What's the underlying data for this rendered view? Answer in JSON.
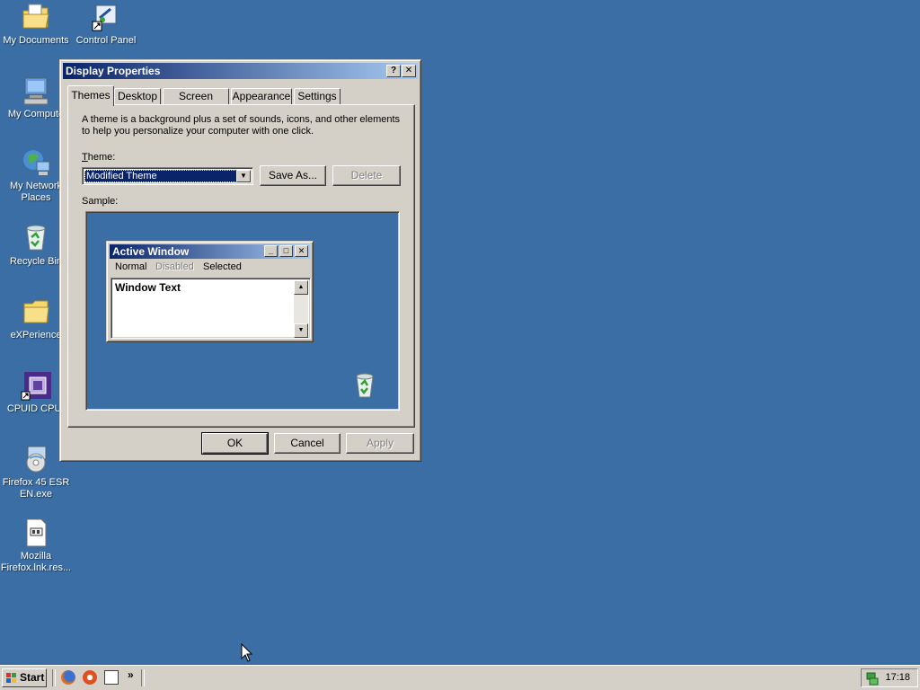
{
  "desktop": {
    "icons": [
      {
        "label": "My Documents",
        "icon": "folder-documents-icon"
      },
      {
        "label": "Control Panel",
        "icon": "control-panel-icon"
      },
      {
        "label": "My Computer",
        "icon": "computer-icon"
      },
      {
        "label": "My Network Places",
        "icon": "network-icon"
      },
      {
        "label": "Recycle Bin",
        "icon": "recycle-bin-icon"
      },
      {
        "label": "eXPerience",
        "icon": "folder-icon"
      },
      {
        "label": "CPUID CPU-Z",
        "icon": "cpuz-icon"
      },
      {
        "label": "Firefox 45 ESR EN.exe",
        "icon": "installer-icon"
      },
      {
        "label": "Mozilla Firefox.lnk.res...",
        "icon": "file-icon"
      }
    ],
    "icon_labels_visible": {
      "my_documents": "My Documents",
      "control_panel": "Control Panel",
      "my_computer": "My Compute",
      "network_1": "My Network",
      "network_2": "Places",
      "recycle": "Recycle Bin",
      "experience": "eXPerience",
      "cpuz": "CPUID CPU-",
      "firefox_1": "Firefox 45 ESR",
      "firefox_2": "EN.exe",
      "mozilla_1": "Mozilla",
      "mozilla_2": "Firefox.lnk.res..."
    }
  },
  "dialog": {
    "title": "Display Properties",
    "help_btn": "?",
    "close_btn": "✕",
    "tabs": [
      "Themes",
      "Desktop",
      "Screen Saver",
      "Appearance",
      "Settings"
    ],
    "active_tab": "Themes",
    "description": "A theme is a background plus a set of sounds, icons, and other elements to help you personalize your computer with one click.",
    "theme_label": "Theme:",
    "theme_value": "Modified Theme",
    "save_as": "Save As...",
    "delete": "Delete",
    "sample_label": "Sample:",
    "ok": "OK",
    "cancel": "Cancel",
    "apply": "Apply"
  },
  "sample": {
    "window_title": "Active Window",
    "menu_normal": "Normal",
    "menu_disabled": "Disabled",
    "menu_selected": "Selected",
    "window_text": "Window Text"
  },
  "taskbar": {
    "start": "Start",
    "chevron": "»",
    "clock": "17:18"
  },
  "colors": {
    "desktop": "#3a6ea5",
    "titlebar_start": "#0a246a",
    "titlebar_end": "#a6caf0",
    "face": "#d4d0c8"
  }
}
